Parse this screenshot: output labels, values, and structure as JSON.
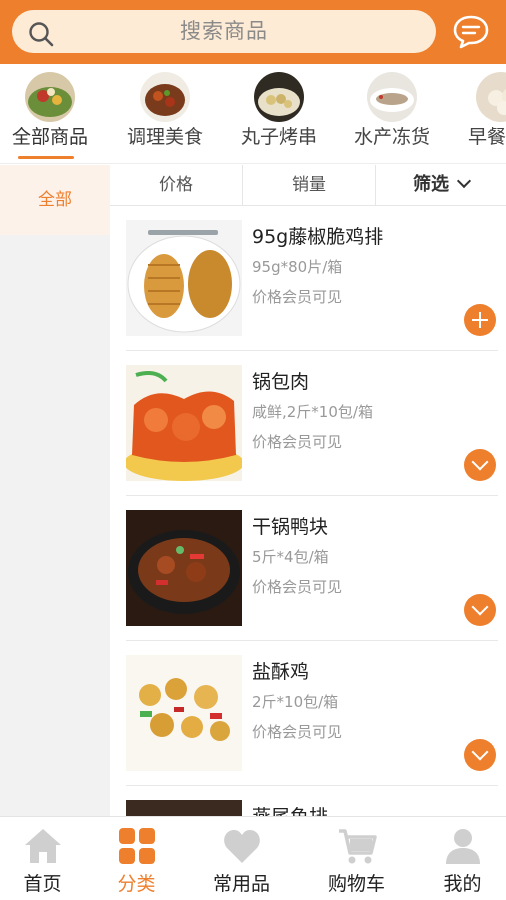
{
  "header": {
    "search_placeholder": "搜索商品",
    "message_icon": "message-icon",
    "search_icon": "search-icon"
  },
  "colors": {
    "accent": "#ee7f2d",
    "search_bg": "#fdebd6",
    "side_bg": "#f2f2f2",
    "side_active_bg": "#fdf2ea"
  },
  "categories": [
    {
      "label": "全部商品",
      "active": true
    },
    {
      "label": "调理美食",
      "active": false
    },
    {
      "label": "丸子烤串",
      "active": false
    },
    {
      "label": "水产冻货",
      "active": false
    },
    {
      "label": "早餐",
      "active": false
    }
  ],
  "sidebar": {
    "items": [
      {
        "label": "全部",
        "active": true
      }
    ]
  },
  "sort": {
    "price_label": "价格",
    "sales_label": "销量",
    "filter_label": "筛选"
  },
  "products": [
    {
      "name": "95g藤椒脆鸡排",
      "spec": "95g*80片/箱",
      "price": "价格会员可见",
      "action": "add"
    },
    {
      "name": "锅包肉",
      "spec": "咸鲜,2斤*10包/箱",
      "price": "价格会员可见",
      "action": "expand"
    },
    {
      "name": "干锅鸭块",
      "spec": "5斤*4包/箱",
      "price": "价格会员可见",
      "action": "expand"
    },
    {
      "name": "盐酥鸡",
      "spec": "2斤*10包/箱",
      "price": "价格会员可见",
      "action": "expand"
    },
    {
      "name": "燕尾鱼排",
      "spec": "",
      "price": "",
      "action": ""
    }
  ],
  "tabs": [
    {
      "label": "首页",
      "icon": "home-icon",
      "active": false
    },
    {
      "label": "分类",
      "icon": "category-grid-icon",
      "active": true
    },
    {
      "label": "常用品",
      "icon": "heart-icon",
      "active": false
    },
    {
      "label": "购物车",
      "icon": "cart-icon",
      "active": false
    },
    {
      "label": "我的",
      "icon": "user-icon",
      "active": false
    }
  ]
}
